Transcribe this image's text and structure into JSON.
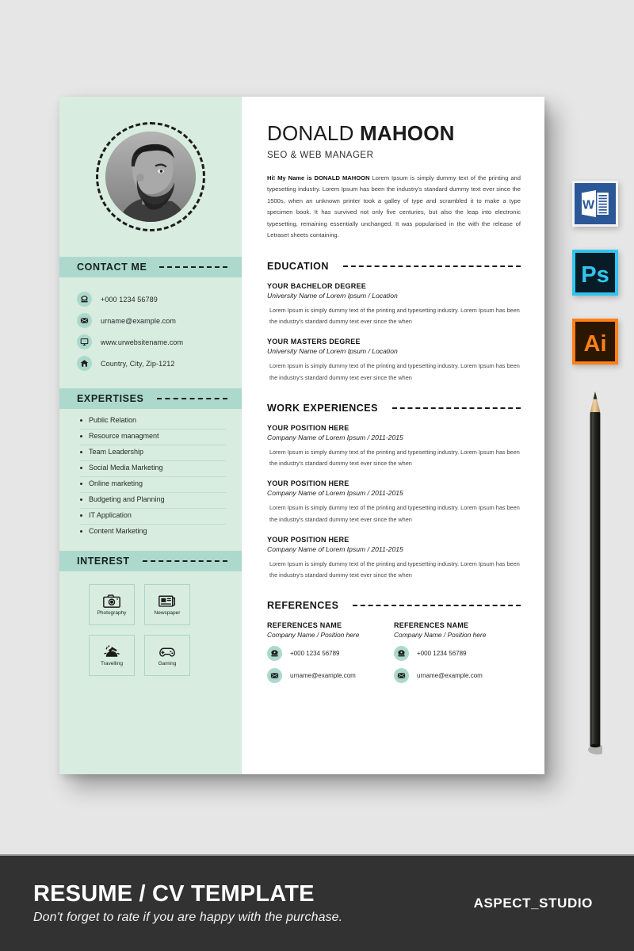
{
  "resume": {
    "name_first": "DONALD",
    "name_last": "MAHOON",
    "job_title": "SEO & WEB MANAGER",
    "intro_bold": "Hi! My Name is DONALD MAHOON",
    "intro_text": " Lorem Ipsum is simply dummy text of the printing and typesetting industry. Lorem Ipsum has been the industry's standard dummy text ever since the 1500s, when an unknown printer took a galley of type and scrambled it to make a type specimen book. It has survived not only five centuries, but also the leap into electronic typesetting, remaining essentially unchanged. It was popularised in the with the release of Letraset sheets containing.",
    "sidebar": {
      "contact": {
        "heading": "CONTACT ME",
        "items": [
          {
            "icon": "phone-icon",
            "text": "+000 1234 56789"
          },
          {
            "icon": "envelope-icon",
            "text": "urname@example.com"
          },
          {
            "icon": "monitor-icon",
            "text": "www.urwebsitename.com"
          },
          {
            "icon": "home-icon",
            "text": "Country, City, Zip-1212"
          }
        ]
      },
      "expertises": {
        "heading": "EXPERTISES",
        "items": [
          "Public Relation",
          "Resource managment",
          "Team Leadership",
          "Social Media Marketing",
          "Online marketing",
          "Budgeting and Planning",
          "IT Application",
          "Content Marketing"
        ]
      },
      "interest": {
        "heading": "INTEREST",
        "items": [
          {
            "icon": "camera-icon",
            "label": "Photography"
          },
          {
            "icon": "newspaper-icon",
            "label": "Newspaper"
          },
          {
            "icon": "travel-icon",
            "label": "Travelling"
          },
          {
            "icon": "gamepad-icon",
            "label": "Gaming"
          }
        ]
      }
    },
    "education": {
      "heading": "EDUCATION",
      "entries": [
        {
          "title": "YOUR BACHELOR DEGREE",
          "subtitle": "University Name of Lorem Ipsum / Location",
          "desc": "Lorem Ipsum is simply dummy text of the printing and typesetting industry. Lorem Ipsum has been the industry's standard dummy text ever since the  when"
        },
        {
          "title": "YOUR MASTERS DEGREE",
          "subtitle": "University Name of Lorem Ipsum / Location",
          "desc": "Lorem Ipsum is simply dummy text of the printing and typesetting industry. Lorem Ipsum has been the industry's standard dummy text ever since the  when"
        }
      ]
    },
    "work": {
      "heading": "WORK EXPERIENCES",
      "entries": [
        {
          "title": "YOUR POSITION HERE",
          "subtitle": "Company Name of Lorem Ipsum / 2011-2015",
          "desc": "Lorem Ipsum is simply dummy text of the printing and typesetting industry. Lorem Ipsum has been the industry's standard dummy text ever since the  when"
        },
        {
          "title": "YOUR POSITION HERE",
          "subtitle": "Company Name of Lorem Ipsum / 2011-2015",
          "desc": "Lorem Ipsum is simply dummy text of the printing and typesetting industry. Lorem Ipsum has been the industry's standard dummy text ever since the  when"
        },
        {
          "title": "YOUR POSITION HERE",
          "subtitle": "Company Name of Lorem Ipsum / 2011-2015",
          "desc": "Lorem Ipsum is simply dummy text of the printing and typesetting industry. Lorem Ipsum has been the industry's standard dummy text ever since the  when"
        }
      ]
    },
    "references": {
      "heading": "REFERENCES",
      "entries": [
        {
          "name": "REFERENCES NAME",
          "subtitle": "Company Name / Position here",
          "phone": "+000 1234 56789",
          "email": "urname@example.com"
        },
        {
          "name": "REFERENCES NAME",
          "subtitle": "Company Name / Position here",
          "phone": "+000 1234 56789",
          "email": "urname@example.com"
        }
      ]
    }
  },
  "software_icons": [
    {
      "name": "microsoft-word-icon",
      "label": "W",
      "bg": "#2b5797",
      "border": "#f2f2f2"
    },
    {
      "name": "adobe-photoshop-icon",
      "label": "Ps",
      "bg": "#071c27",
      "border": "#31c5f0"
    },
    {
      "name": "adobe-illustrator-icon",
      "label": "Ai",
      "bg": "#2b1700",
      "border": "#ff7f18"
    }
  ],
  "banner": {
    "title": "RESUME / CV TEMPLATE",
    "subtitle": "Don't forget to rate if you are happy with the purchase.",
    "brand": "ASPECT_STUDIO"
  },
  "colors": {
    "page_background": "#e6e6e6",
    "sidebar": "#d8ecdf",
    "sidebar_header": "#add9cd",
    "banner": "#323232",
    "paper": "#ffffff"
  }
}
